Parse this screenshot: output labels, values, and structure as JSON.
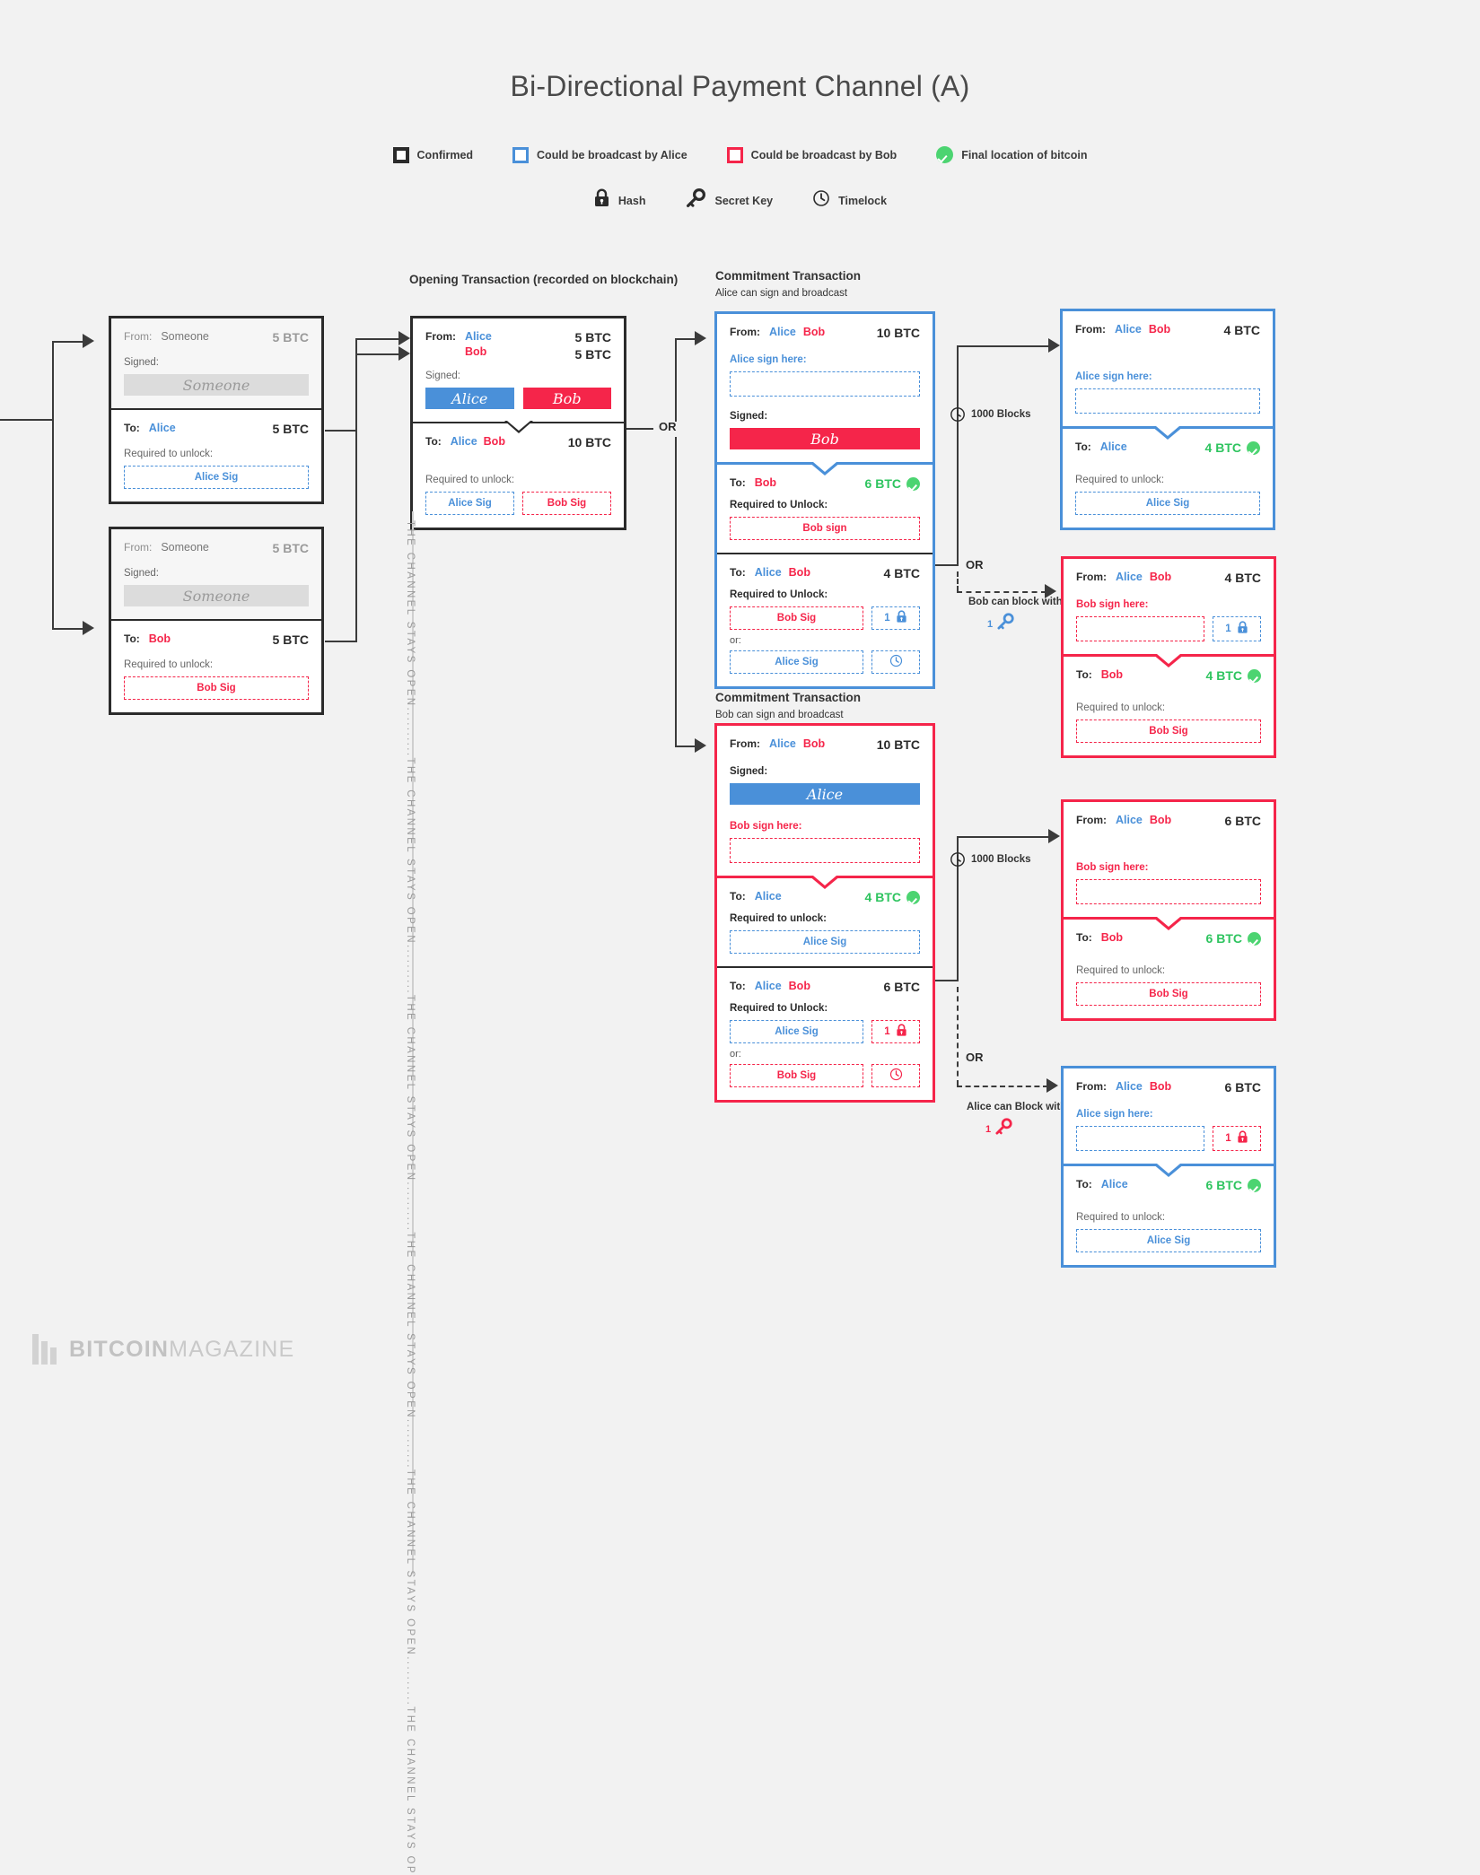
{
  "title": "Bi-Directional Payment Channel (A)",
  "legend": {
    "row1": [
      {
        "icon": "black-square-icon",
        "label": "Confirmed"
      },
      {
        "icon": "blue-square-icon",
        "label": "Could be broadcast by Alice"
      },
      {
        "icon": "red-square-icon",
        "label": "Could be broadcast by Bob"
      },
      {
        "icon": "green-check-icon",
        "label": "Final location of bitcoin"
      }
    ],
    "row2": [
      {
        "icon": "lock-icon",
        "label": "Hash"
      },
      {
        "icon": "key-icon",
        "label": "Secret Key"
      },
      {
        "icon": "clock-icon",
        "label": "Timelock"
      }
    ]
  },
  "labels": {
    "from": "From:",
    "to": "To:",
    "signed": "Signed:",
    "required_unlock_lc": "Required to unlock:",
    "required_unlock_uc": "Required to Unlock:",
    "or_lower": "or:",
    "or": "OR",
    "alice": "Alice",
    "bob": "Bob",
    "someone": "Someone"
  },
  "headings": {
    "opening": "Opening Transaction (recorded on blockchain)",
    "commitment_a_title": "Commitment Transaction",
    "commitment_a_sub": "Alice can sign and broadcast",
    "commitment_b_title": "Commitment Transaction",
    "commitment_b_sub": "Bob can sign and broadcast"
  },
  "funding_alice": {
    "from_label": "From:",
    "from_name": "Someone",
    "from_amount": "5 BTC",
    "signed_label": "Signed:",
    "signature": "Someone",
    "to_label": "To:",
    "to_name": "Alice",
    "to_amount": "5 BTC",
    "unlock_label": "Required to unlock:",
    "unlock_value": "Alice Sig"
  },
  "funding_bob": {
    "from_label": "From:",
    "from_name": "Someone",
    "from_amount": "5 BTC",
    "signed_label": "Signed:",
    "signature": "Someone",
    "to_label": "To:",
    "to_name": "Bob",
    "to_amount": "5 BTC",
    "unlock_label": "Required to unlock:",
    "unlock_value": "Bob Sig"
  },
  "opening_tx": {
    "from_label": "From:",
    "from_alice": "Alice",
    "from_bob": "Bob",
    "amount_alice": "5 BTC",
    "amount_bob": "5 BTC",
    "signed_label": "Signed:",
    "sig_alice": "Alice",
    "sig_bob": "Bob",
    "to_label": "To:",
    "to_alice": "Alice",
    "to_bob": "Bob",
    "to_amount": "10 BTC",
    "unlock_label": "Required to unlock:",
    "unlock_alice": "Alice Sig",
    "unlock_bob": "Bob Sig"
  },
  "commitment_a": {
    "from_label": "From:",
    "from_alice": "Alice",
    "from_bob": "Bob",
    "amount": "10 BTC",
    "sign_here_label": "Alice sign here:",
    "signed_label": "Signed:",
    "signature": "Bob",
    "out1": {
      "to_label": "To:",
      "to_name": "Bob",
      "amount": "6 BTC",
      "final": true,
      "unlock_label": "Required to Unlock:",
      "unlock_value": "Bob sign"
    },
    "out2": {
      "to_label": "To:",
      "to_alice": "Alice",
      "to_bob": "Bob",
      "amount": "4 BTC",
      "unlock_label": "Required to Unlock:",
      "primary": "Bob Sig",
      "primary_chip_num": "1",
      "primary_chip_icon": "lock-icon",
      "or_label": "or:",
      "secondary": "Alice Sig",
      "secondary_chip_icon": "clock-icon"
    }
  },
  "commitment_b": {
    "from_label": "From:",
    "from_alice": "Alice",
    "from_bob": "Bob",
    "amount": "10 BTC",
    "signed_label": "Signed:",
    "signature": "Alice",
    "sign_here_label": "Bob sign here:",
    "out1": {
      "to_label": "To:",
      "to_name": "Alice",
      "amount": "4 BTC",
      "final": true,
      "unlock_label": "Required to unlock:",
      "unlock_value": "Alice Sig"
    },
    "out2": {
      "to_label": "To:",
      "to_alice": "Alice",
      "to_bob": "Bob",
      "amount": "6 BTC",
      "unlock_label": "Required to Unlock:",
      "primary": "Alice Sig",
      "primary_chip_num": "1",
      "primary_chip_icon": "lock-icon",
      "or_label": "or:",
      "secondary": "Bob Sig",
      "secondary_chip_icon": "clock-icon"
    }
  },
  "settle_a_timeout": {
    "from_label": "From:",
    "from_alice": "Alice",
    "from_bob": "Bob",
    "amount": "4 BTC",
    "sign_here_label": "Alice sign here:",
    "to_label": "To:",
    "to_name": "Alice",
    "to_amount": "4 BTC",
    "unlock_label": "Required to unlock:",
    "unlock_value": "Alice Sig"
  },
  "settle_a_block": {
    "from_label": "From:",
    "from_alice": "Alice",
    "from_bob": "Bob",
    "amount": "4 BTC",
    "sign_here_label": "Bob sign here:",
    "chip_num": "1",
    "chip_icon": "lock-icon",
    "to_label": "To:",
    "to_name": "Bob",
    "to_amount": "4 BTC",
    "unlock_label": "Required to unlock:",
    "unlock_value": "Bob Sig"
  },
  "settle_b_timeout": {
    "from_label": "From:",
    "from_alice": "Alice",
    "from_bob": "Bob",
    "amount": "6 BTC",
    "sign_here_label": "Bob sign here:",
    "to_label": "To:",
    "to_name": "Bob",
    "to_amount": "6 BTC",
    "unlock_label": "Required to unlock:",
    "unlock_value": "Bob Sig"
  },
  "settle_b_block": {
    "from_label": "From:",
    "from_alice": "Alice",
    "from_bob": "Bob",
    "amount": "6 BTC",
    "sign_here_label": "Alice sign here:",
    "chip_num": "1",
    "chip_icon": "lock-icon",
    "to_label": "To:",
    "to_name": "Alice",
    "to_amount": "6 BTC",
    "unlock_label": "Required to unlock:",
    "unlock_value": "Alice Sig"
  },
  "annotations": {
    "blocks_top": "1000 Blocks",
    "blocks_bottom": "1000 Blocks",
    "or_top": "OR",
    "or_mid": "OR",
    "or_bottom": "OR",
    "or_left": "OR",
    "bob_block": "Bob can block with",
    "bob_block_key_num": "1",
    "alice_block": "Alice can Block with",
    "alice_block_key_num": "1",
    "channel_open": "THE CHANNEL STAYS OPEN..........THE CHANNEL STAYS OPEN..........THE CHANNEL STAYS OPEN..........THE CHANNEL STAYS OPEN..........THE CHANNEL STAYS OPEN..........THE CHANNEL STAYS OP"
  },
  "watermark": {
    "brand_bold": "BITCOIN",
    "brand_light": "MAGAZINE"
  },
  "colors": {
    "alice": "#4a90d9",
    "bob": "#f5254a",
    "confirmed": "#2b2b2b",
    "final": "#2ec45f",
    "background": "#f2f2f2"
  }
}
